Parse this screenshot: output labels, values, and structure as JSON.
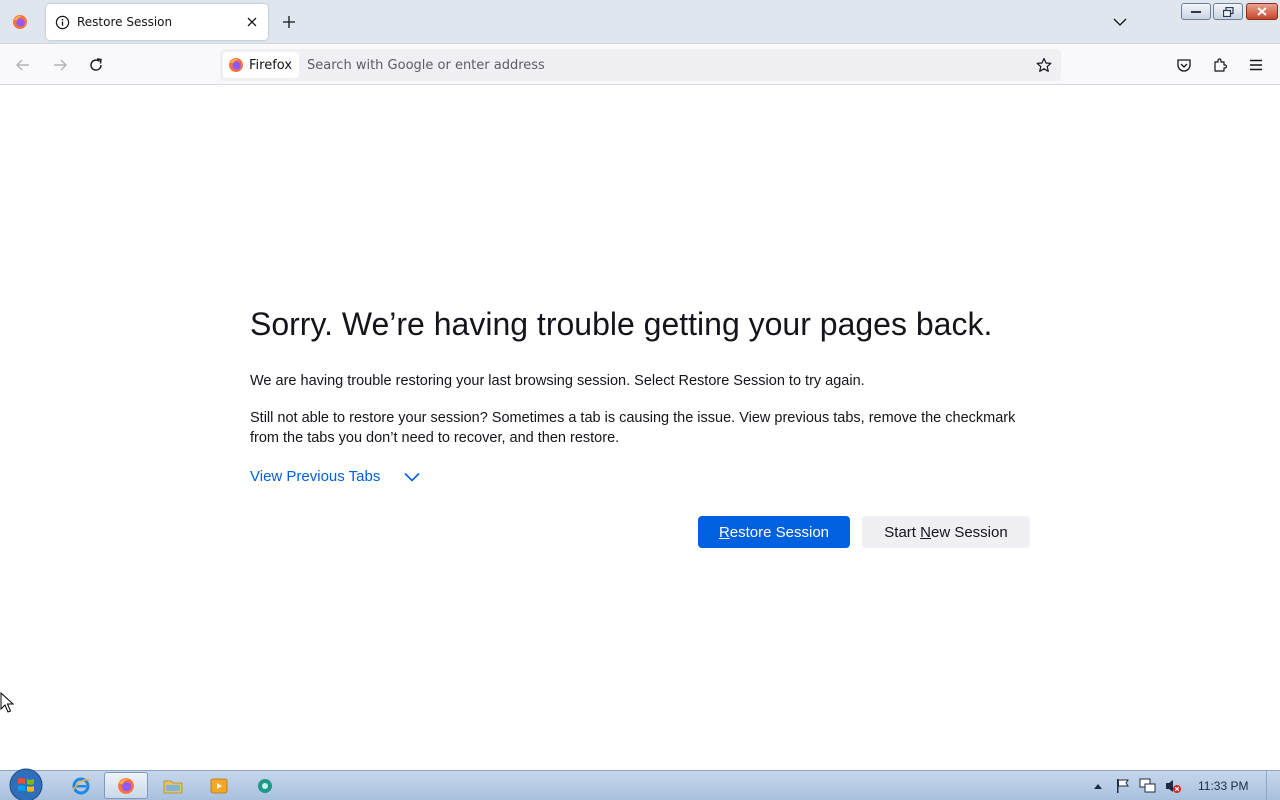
{
  "browser": {
    "tab": {
      "title": "Restore Session",
      "icon": "info-icon"
    },
    "identity_label": "Firefox",
    "urlbar": {
      "value": "",
      "placeholder": "Search with Google or enter address"
    }
  },
  "page": {
    "title": "Sorry. We’re having trouble getting your pages back.",
    "paragraph1": "We are having trouble restoring your last browsing session. Select Restore Session to try again.",
    "paragraph2": "Still not able to restore your session? Sometimes a tab is causing the issue. View previous tabs, remove the checkmark from the tabs you don’t need to recover, and then restore.",
    "view_previous": "View Previous Tabs",
    "buttons": {
      "restore": {
        "accesskey": "R",
        "rest": "estore Session"
      },
      "new_session": {
        "pre": "Start ",
        "accesskey": "N",
        "rest": "ew Session"
      }
    }
  },
  "taskbar": {
    "clock": "11:33 PM",
    "items": [
      "internet-explorer-icon",
      "firefox-icon",
      "file-explorer-icon",
      "media-player-icon",
      "app-icon"
    ]
  },
  "colors": {
    "accent": "#0061e0",
    "text": "#15141a",
    "tabstrip": "#dfe6ee"
  }
}
